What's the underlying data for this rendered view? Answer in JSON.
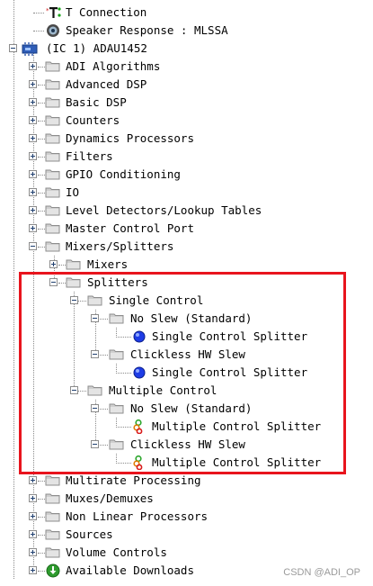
{
  "tree": {
    "items": [
      {
        "label": "T Connection",
        "icon": "t-connection-icon"
      },
      {
        "label": "Speaker Response : MLSSA",
        "icon": "speaker-icon"
      },
      {
        "label": "(IC 1) ADAU1452",
        "icon": "chip-icon"
      },
      {
        "label": "ADI Algorithms",
        "icon": "folder-icon"
      },
      {
        "label": "Advanced DSP",
        "icon": "folder-icon"
      },
      {
        "label": "Basic DSP",
        "icon": "folder-icon"
      },
      {
        "label": "Counters",
        "icon": "folder-icon"
      },
      {
        "label": "Dynamics Processors",
        "icon": "folder-icon"
      },
      {
        "label": "Filters",
        "icon": "folder-icon"
      },
      {
        "label": "GPIO Conditioning",
        "icon": "folder-icon"
      },
      {
        "label": "IO",
        "icon": "folder-icon"
      },
      {
        "label": "Level Detectors/Lookup Tables",
        "icon": "folder-icon"
      },
      {
        "label": "Master Control Port",
        "icon": "folder-icon"
      },
      {
        "label": "Mixers/Splitters",
        "icon": "folder-icon"
      },
      {
        "label": "Mixers",
        "icon": "folder-icon"
      },
      {
        "label": "Splitters",
        "icon": "folder-icon"
      },
      {
        "label": "Single Control",
        "icon": "folder-icon"
      },
      {
        "label": "No Slew (Standard)",
        "icon": "folder-icon"
      },
      {
        "label": "Single Control Splitter",
        "icon": "blue-circle-block-icon"
      },
      {
        "label": "Clickless HW Slew",
        "icon": "folder-icon"
      },
      {
        "label": "Single Control Splitter",
        "icon": "blue-circle-block-icon"
      },
      {
        "label": "Multiple Control",
        "icon": "folder-icon"
      },
      {
        "label": "No Slew (Standard)",
        "icon": "folder-icon"
      },
      {
        "label": "Multiple Control Splitter",
        "icon": "multi-splitter-icon"
      },
      {
        "label": "Clickless HW Slew",
        "icon": "folder-icon"
      },
      {
        "label": "Multiple Control Splitter",
        "icon": "multi-splitter-icon"
      },
      {
        "label": "Multirate Processing",
        "icon": "folder-icon"
      },
      {
        "label": "Muxes/Demuxes",
        "icon": "folder-icon"
      },
      {
        "label": "Non Linear Processors",
        "icon": "folder-icon"
      },
      {
        "label": "Sources",
        "icon": "folder-icon"
      },
      {
        "label": "Volume Controls",
        "icon": "folder-icon"
      },
      {
        "label": "Available Downloads",
        "icon": "download-icon"
      }
    ]
  },
  "colors": {
    "highlight_box": "#e8141d",
    "folder": "#c8c8c8",
    "splitter_blue": "#1e3ce6",
    "download_green": "#2e9b2e"
  },
  "watermark": "CSDN @ADI_OP"
}
